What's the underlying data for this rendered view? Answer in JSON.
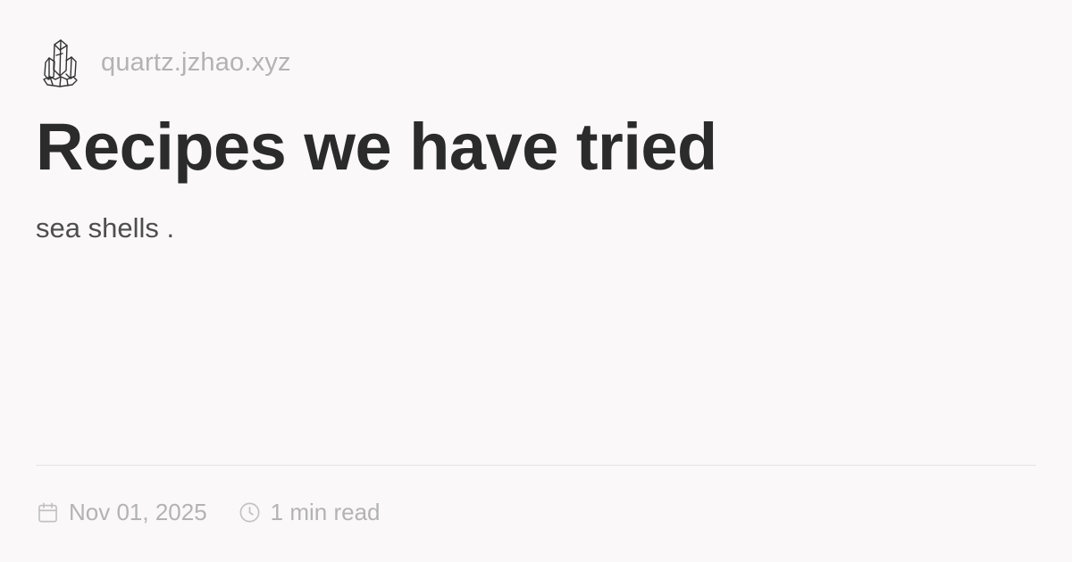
{
  "site": {
    "logo_icon": "crystal-icon",
    "name": "quartz.jzhao.xyz"
  },
  "page": {
    "title": "Recipes we have tried",
    "description": "sea shells ."
  },
  "meta": {
    "date_icon": "calendar-icon",
    "date": "Nov 01, 2025",
    "reading_icon": "clock-icon",
    "reading_time": "1 min read"
  },
  "colors": {
    "background": "#faf8f8",
    "title": "#2b2b2b",
    "muted": "#b3b3b3"
  }
}
